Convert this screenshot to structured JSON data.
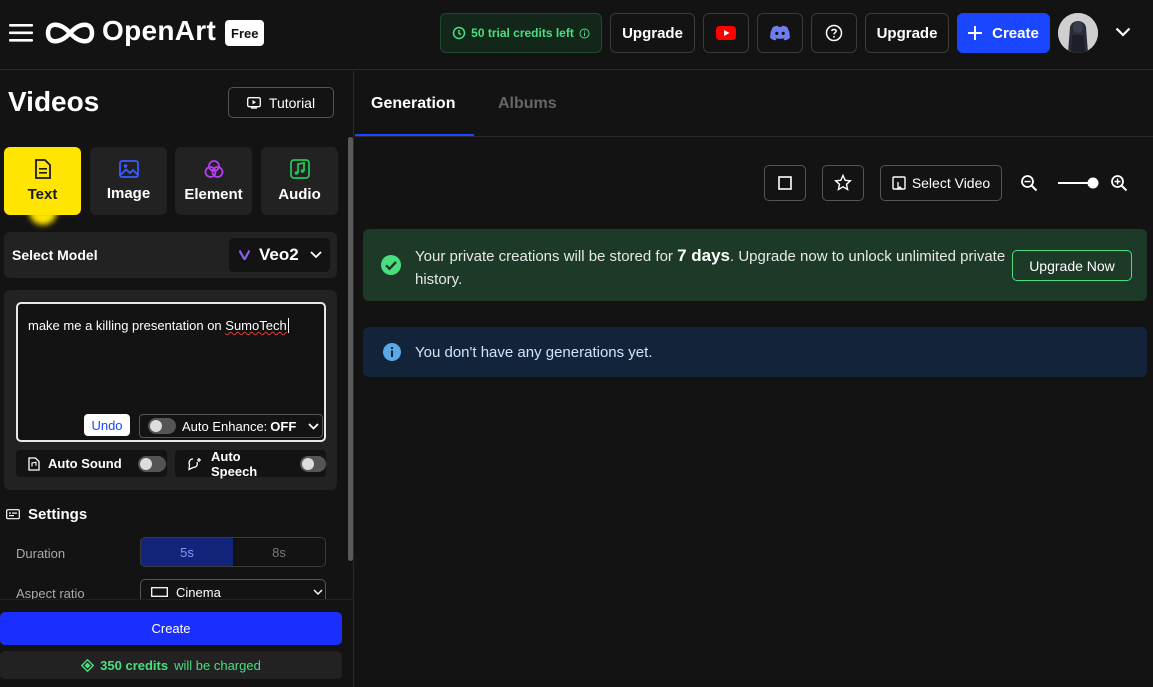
{
  "header": {
    "brand": "OpenArt",
    "plan_badge": "Free",
    "trial_credits": "50 trial credits left",
    "upgrade_label_1": "Upgrade",
    "upgrade_label_2": "Upgrade",
    "create_label": "Create"
  },
  "left": {
    "title": "Videos",
    "tutorial_label": "Tutorial",
    "tabs": [
      {
        "label": "Text",
        "icon": "document-icon",
        "active": true
      },
      {
        "label": "Image",
        "icon": "image-icon",
        "active": false
      },
      {
        "label": "Element",
        "icon": "element-icon",
        "active": false
      },
      {
        "label": "Audio",
        "icon": "music-icon",
        "active": false
      }
    ],
    "model": {
      "label": "Select Model",
      "value": "Veo2"
    },
    "prompt": {
      "text_before": "make me a killing presentation on ",
      "text_misspelled": "SumoTech"
    },
    "undo_label": "Undo",
    "auto_enhance": {
      "label": "Auto Enhance:",
      "state": "OFF"
    },
    "auto_sound_label": "Auto Sound",
    "auto_speech_label": "Auto Speech",
    "settings": {
      "title": "Settings",
      "duration_label": "Duration",
      "duration_options": [
        "5s",
        "8s"
      ],
      "duration_selected": "5s",
      "aspect_label": "Aspect ratio",
      "aspect_value": "Cinema"
    },
    "create_label": "Create",
    "credits": {
      "amount": "350 credits",
      "suffix": "will be charged"
    }
  },
  "right": {
    "tabs": [
      {
        "label": "Generation",
        "active": true
      },
      {
        "label": "Albums",
        "active": false
      }
    ],
    "select_video_label": "Select Video",
    "notice": {
      "text_before": "Your private creations will be stored for ",
      "highlight": "7 days",
      "text_after": ". Upgrade now to unlock unlimited private history."
    },
    "upgrade_now_label": "Upgrade Now",
    "info_text": "You don't have any generations yet.",
    "zoom_level": 0.8
  },
  "colors": {
    "accent_blue": "#1a46ff",
    "active_tab_yellow": "#ffe500",
    "success_green": "#4ade80",
    "background": "#131313"
  }
}
